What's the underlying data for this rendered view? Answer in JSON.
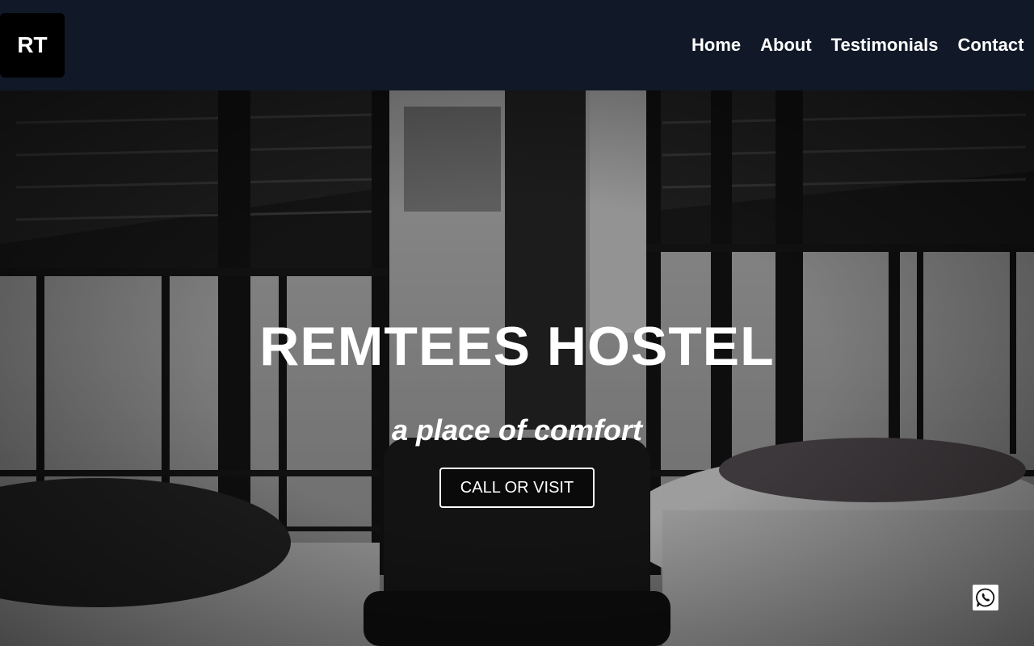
{
  "header": {
    "logo_text": "RT",
    "nav": {
      "home": "Home",
      "about": "About",
      "testimonials": "Testimonials",
      "contact": "Contact"
    }
  },
  "hero": {
    "title": "REMTEES HOSTEL",
    "tagline": "a place of comfort",
    "cta_label": "CALL OR VISIT"
  },
  "floating": {
    "whatsapp_icon": "whatsapp-icon"
  },
  "colors": {
    "header_bg": "#111827",
    "logo_bg": "#000000",
    "text": "#ffffff"
  }
}
